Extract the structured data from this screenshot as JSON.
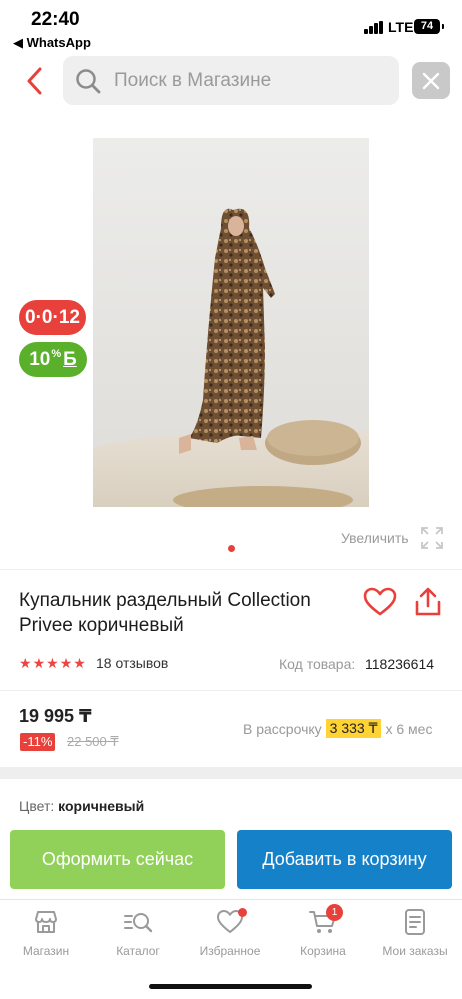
{
  "status_bar": {
    "time": "22:40",
    "back_app": "◀ WhatsApp",
    "network": "LTE",
    "battery": "74"
  },
  "search": {
    "placeholder": "Поиск в Магазине"
  },
  "badges": {
    "timer": "0·0·12",
    "bonus_percent": "10",
    "bonus_suffix": "%",
    "bonus_currency": "Б"
  },
  "gallery": {
    "zoom_label": "Увеличить",
    "current_slide": 1,
    "total_slides": 1
  },
  "product": {
    "title": "Купальник раздельный Collection Privee коричневый",
    "rating": 5,
    "reviews": "18 отзывов",
    "sku_label": "Код товара:",
    "sku_value": "118236614",
    "price": "19 995 ₸",
    "discount": "-11%",
    "old_price": "22 500 ₸",
    "installment_prefix": "В рассрочку",
    "installment_amount": "3 333 ₸",
    "installment_suffix": "х 6 мес",
    "color_label": "Цвет:",
    "color_value": "коричневый"
  },
  "actions": {
    "checkout": "Оформить сейчас",
    "add_to_cart": "Добавить в корзину"
  },
  "tabs": [
    {
      "label": "Магазин",
      "icon": "store-icon"
    },
    {
      "label": "Каталог",
      "icon": "catalog-search-icon"
    },
    {
      "label": "Избранное",
      "icon": "heart-icon"
    },
    {
      "label": "Корзина",
      "icon": "cart-icon",
      "badge": "1"
    },
    {
      "label": "Мои заказы",
      "icon": "orders-icon"
    }
  ],
  "colors": {
    "accent_red": "#e8413b",
    "bonus_green": "#5ab02b",
    "checkout_green": "#92d159",
    "cart_blue": "#1481c9",
    "installment_yellow": "#ffd333"
  }
}
